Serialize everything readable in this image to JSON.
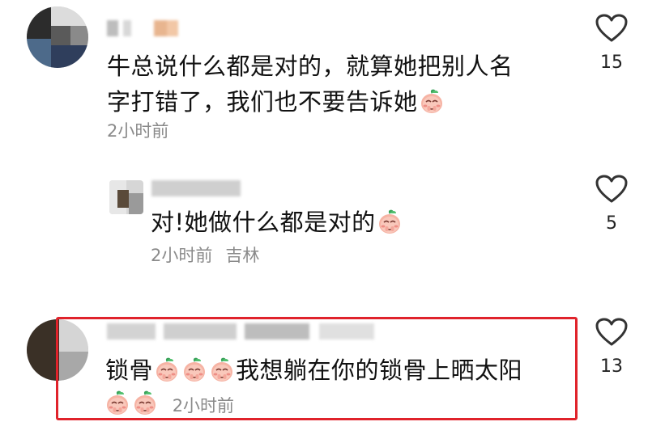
{
  "comments": [
    {
      "text_line1": "牛总说什么都是对的，就算她把别人名",
      "text_line2": "字打错了，我们也不要告诉她",
      "time": "2小时前",
      "likes": "15",
      "emoji": "peach-face-icon"
    },
    {
      "reply": true,
      "text": "对!她做什么都是对的",
      "time": "2小时前",
      "location": "吉林",
      "likes": "5",
      "emoji": "peach-face-icon"
    },
    {
      "text_part1": "锁骨",
      "text_part2": "我想躺在你的锁骨上晒太阳",
      "time": "2小时前",
      "likes": "13",
      "emoji": "peach-face-icon"
    }
  ],
  "colors": {
    "highlight_border": "#e0232b",
    "meta_text": "#8a8a8a",
    "heart_stroke": "#333333"
  }
}
